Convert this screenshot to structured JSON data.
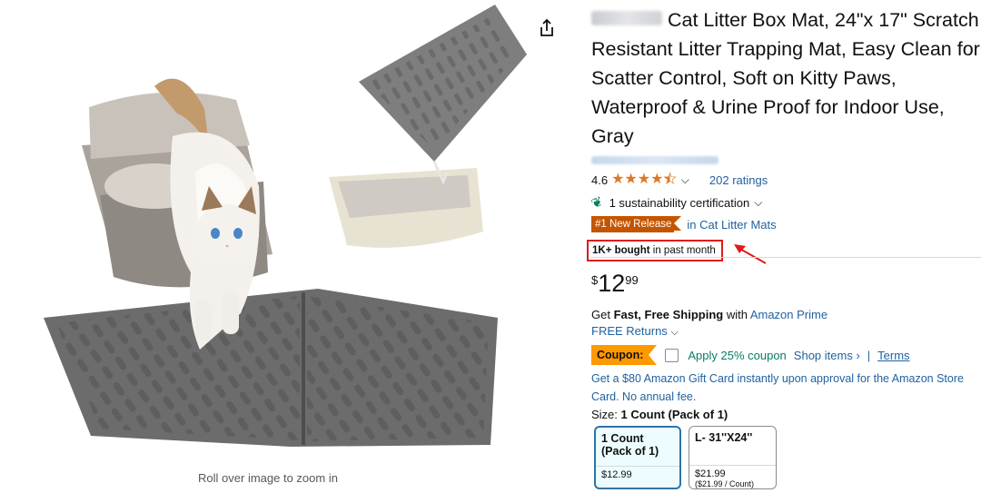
{
  "image": {
    "zoom_hint": "Roll over image to zoom in"
  },
  "product": {
    "title": "Cat Litter Box Mat, 24\"x 17\" Scratch Resistant Litter Trapping Mat, Easy Clean for Scatter Control, Soft on Kitty Paws, Waterproof & Urine Proof for Indoor Use, Gray",
    "rating_value": "4.6",
    "rating_stars": 4.5,
    "ratings_link": "202 ratings",
    "sustainability": "1 sustainability certification",
    "badge": "#1 New Release",
    "badge_category": "in Cat Litter Mats",
    "bought_bold": "1K+ bought",
    "bought_rest": " in past month"
  },
  "price": {
    "symbol": "$",
    "whole": "12",
    "fraction": "99"
  },
  "shipping": {
    "prefix": "Get ",
    "bold": "Fast, Free Shipping",
    "middle": " with ",
    "prime_link": "Amazon Prime",
    "returns": "FREE Returns"
  },
  "coupon": {
    "label": "Coupon:",
    "apply": "Apply 25% coupon",
    "shop": "Shop items ›",
    "separator": "|",
    "terms": "Terms"
  },
  "gift_card": "Get a $80 Amazon Gift Card instantly upon approval for the Amazon Store Card. No annual fee.",
  "size": {
    "label": "Size: ",
    "selected": "1 Count (Pack of 1)",
    "options": [
      {
        "name": "1 Count (Pack of 1)",
        "price": "$12.99",
        "unit": ""
      },
      {
        "name": "L- 31''X24''",
        "price": "$21.99",
        "unit": "($21.99 / Count)"
      }
    ]
  },
  "colors": {
    "star": "#de7921",
    "link": "#2162a1",
    "badge": "#c45500",
    "coupon": "#ff9900",
    "highlight": "#e01b1b",
    "selected_border": "#2e73a8"
  }
}
